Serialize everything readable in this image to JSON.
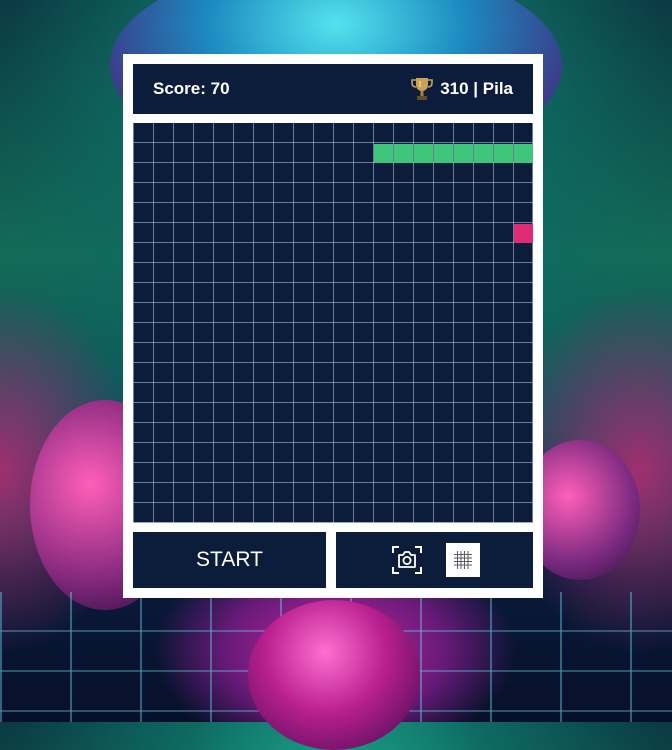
{
  "header": {
    "score_label": "Score: 70",
    "best_label": "310 | Pila"
  },
  "board": {
    "cols": 20,
    "rows": 20,
    "snake": [
      [
        12,
        1
      ],
      [
        13,
        1
      ],
      [
        14,
        1
      ],
      [
        15,
        1
      ],
      [
        16,
        1
      ],
      [
        17,
        1
      ],
      [
        18,
        1
      ],
      [
        19,
        1
      ]
    ],
    "food": [
      19,
      5
    ]
  },
  "controls": {
    "start_label": "START"
  },
  "icons": {
    "trophy": "trophy-icon",
    "screenshot": "camera-icon",
    "grid": "grid-icon"
  },
  "colors": {
    "panel": "#0b1d3b",
    "snake": "#3fc67a",
    "food": "#e02a73",
    "frame": "#ffffff"
  }
}
